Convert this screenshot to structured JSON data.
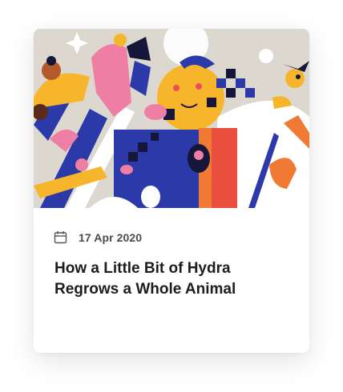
{
  "article_card": {
    "image": {
      "description_icon": "abstract-illustration",
      "palette": {
        "background": "#dcd8cf",
        "navy": "#2b3aa8",
        "yellow": "#f6b52a",
        "pink": "#ee7ea4",
        "orange": "#f07a34",
        "black": "#16163a"
      }
    },
    "date_icon": "calendar-icon",
    "date": "17 Apr 2020",
    "title": "How a Little Bit of Hydra Regrows a Whole Animal"
  }
}
